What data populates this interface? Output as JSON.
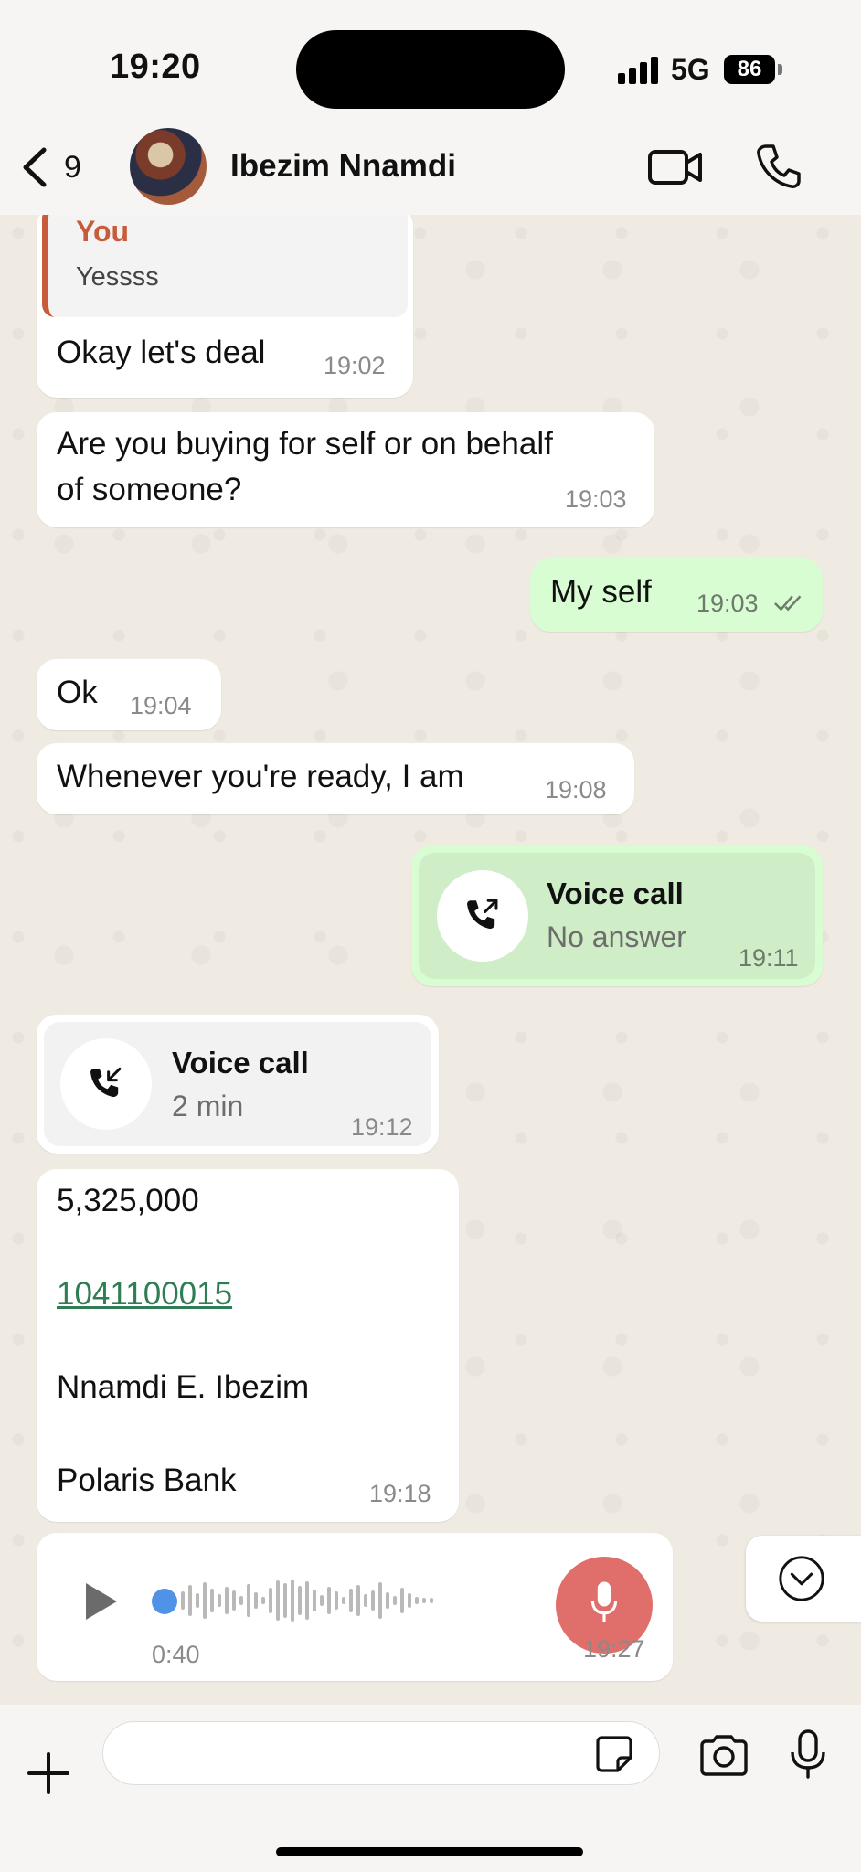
{
  "status_bar": {
    "time": "19:20",
    "network": "5G",
    "battery": "86"
  },
  "header": {
    "back_count": "9",
    "contact_name": "Ibezim Nnamdi"
  },
  "messages": [
    {
      "direction": "in",
      "quote_author": "You",
      "quote_text": "Yessss",
      "text": "Okay let's deal",
      "time": "19:02"
    },
    {
      "direction": "in",
      "text_line1": "Are you buying for self or on behalf",
      "text_line2": "of someone?",
      "time": "19:03"
    },
    {
      "direction": "out",
      "text": "My self",
      "time": "19:03",
      "status": "read"
    },
    {
      "direction": "in",
      "text": "Ok",
      "time": "19:04"
    },
    {
      "direction": "in",
      "text": "Whenever you're ready, I am",
      "time": "19:08"
    },
    {
      "direction": "out",
      "type": "call",
      "title": "Voice call",
      "subtitle": "No answer",
      "time": "19:11"
    },
    {
      "direction": "in",
      "type": "call",
      "title": "Voice call",
      "subtitle": "2 min",
      "time": "19:12"
    },
    {
      "direction": "in",
      "amount": "5,325,000",
      "account": "1041100015",
      "name": "Nnamdi E. Ibezim",
      "bank": "Polaris Bank",
      "time": "19:18"
    },
    {
      "direction": "in",
      "type": "voice",
      "duration": "0:40",
      "time": "19:27"
    }
  ],
  "composer": {
    "placeholder": ""
  }
}
